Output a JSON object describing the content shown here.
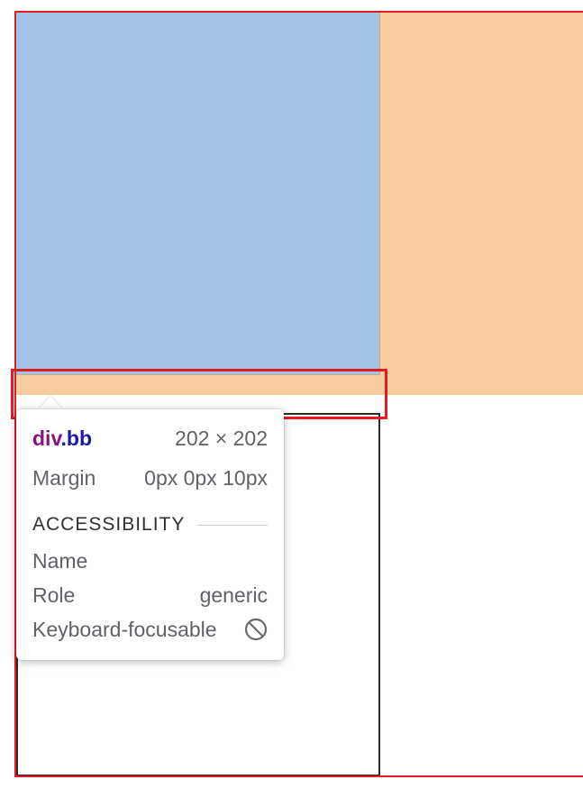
{
  "inspector_tooltip": {
    "element_tag": "div",
    "element_class": ".bb",
    "dimensions": "202 × 202",
    "margin_label": "Margin",
    "margin_value": "0px 0px 10px",
    "accessibility_heading": "ACCESSIBILITY",
    "name_label": "Name",
    "name_value": "",
    "role_label": "Role",
    "role_value": "generic",
    "keyboard_label": "Keyboard-focusable",
    "keyboard_icon": "not-allowed-icon"
  },
  "colors": {
    "highlight_red": "#e31b23",
    "blue_box": "#a2c4e8",
    "orange_region": "#f7cc9e",
    "tag_color": "#881280",
    "class_color": "#1a1aa6"
  }
}
